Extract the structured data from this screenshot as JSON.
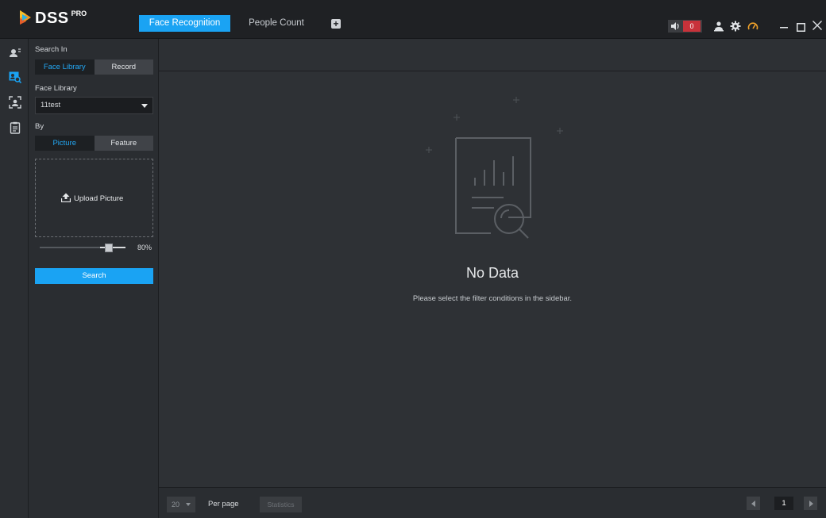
{
  "app": {
    "logo_text": "DSS",
    "logo_sup": "PRO"
  },
  "tabs": [
    {
      "label": "Face Recognition",
      "active": true
    },
    {
      "label": "People Count",
      "active": false
    }
  ],
  "titlebar": {
    "alarm_count": "0"
  },
  "sidebar": {
    "search_in_label": "Search In",
    "search_in_options": [
      "Face Library",
      "Record"
    ],
    "face_library_label": "Face Library",
    "face_library_value": "11test",
    "by_label": "By",
    "by_options": [
      "Picture",
      "Feature"
    ],
    "upload_label": "Upload Picture",
    "similarity_value": "80%",
    "search_button": "Search"
  },
  "main": {
    "empty_title": "No Data",
    "empty_subtitle": "Please select the filter conditions in the sidebar."
  },
  "footer": {
    "per_page_value": "20",
    "per_page_label": "Per page",
    "statistics_button": "Statistics",
    "current_page": "1"
  },
  "colors": {
    "accent": "#1aa3f3",
    "alarm": "#c8323a",
    "background": "#2d3034"
  }
}
